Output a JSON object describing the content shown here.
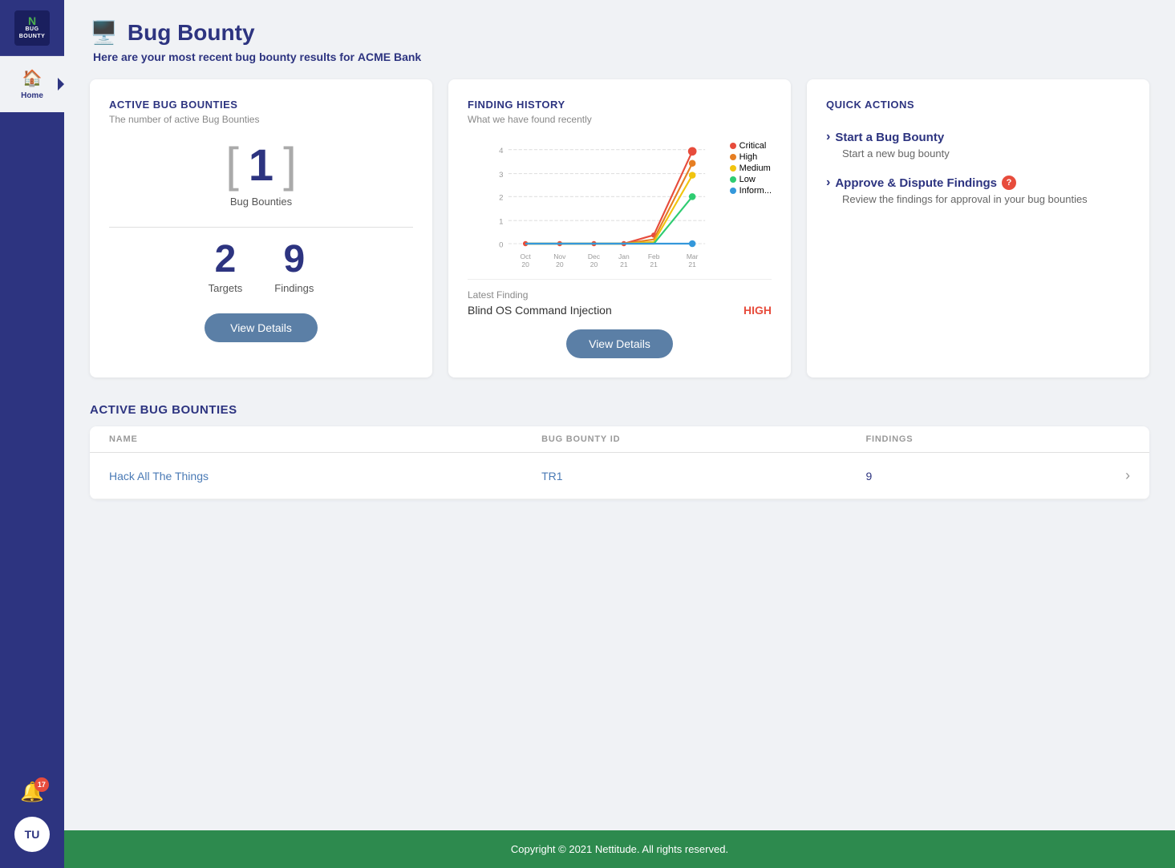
{
  "app": {
    "name": "Bug Bounty",
    "logo_n": "N",
    "logo_sub": "BUG\nBOUNTY"
  },
  "sidebar": {
    "items": [
      {
        "label": "Home",
        "icon": "🏠",
        "active": true
      }
    ],
    "notification_count": "17",
    "user_initials": "TU"
  },
  "header": {
    "title": "Bug Bounty",
    "subtitle_prefix": "Here are your most recent bug bounty results for",
    "subtitle_company": "ACME Bank",
    "icon": "🖥️"
  },
  "active_bounties_card": {
    "title": "ACTIVE BUG BOUNTIES",
    "subtitle": "The number of active Bug Bounties",
    "bounty_count": "1",
    "bounty_label": "Bug Bounties",
    "targets_count": "2",
    "targets_label": "Targets",
    "findings_count": "9",
    "findings_label": "Findings",
    "view_details_label": "View Details"
  },
  "finding_history_card": {
    "title": "FINDING HISTORY",
    "subtitle": "What we have found recently",
    "legend": [
      {
        "label": "Critical",
        "color": "#e74c3c"
      },
      {
        "label": "High",
        "color": "#e67e22"
      },
      {
        "label": "Medium",
        "color": "#f1c40f"
      },
      {
        "label": "Low",
        "color": "#2ecc71"
      },
      {
        "label": "Inform...",
        "color": "#3498db"
      }
    ],
    "x_labels": [
      "Oct\n20",
      "Nov\n20",
      "Dec\n20",
      "Jan\n21",
      "Feb\n21",
      "Mar\n21"
    ],
    "y_labels": [
      "0",
      "1",
      "2",
      "3",
      "4"
    ],
    "latest_finding_label": "Latest Finding",
    "latest_finding_name": "Blind OS Command Injection",
    "latest_finding_severity": "HIGH",
    "view_details_label": "View Details"
  },
  "quick_actions_card": {
    "title": "QUICK ACTIONS",
    "actions": [
      {
        "title": "Start a Bug Bounty",
        "description": "Start a new bug bounty",
        "badge": null
      },
      {
        "title": "Approve & Dispute Findings",
        "description": "Review the findings for approval in your bug bounties",
        "badge": "?"
      }
    ]
  },
  "table_section": {
    "title": "ACTIVE BUG BOUNTIES",
    "columns": [
      "NAME",
      "BUG BOUNTY ID",
      "FINDINGS",
      ""
    ],
    "rows": [
      {
        "name": "Hack All The Things",
        "id": "TR1",
        "findings": "9"
      }
    ]
  },
  "footer": {
    "text": "Copyright © 2021 Nettitude. All rights reserved."
  }
}
